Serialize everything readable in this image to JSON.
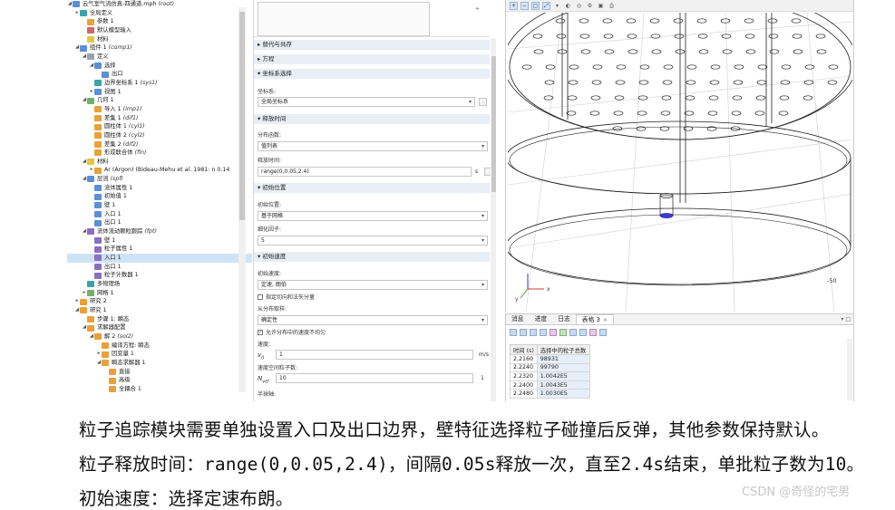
{
  "tree": {
    "rows": [
      {
        "indent": 0,
        "tw": "◢",
        "icon": "blue",
        "text": "云气室气流仿真-四通道.mph",
        "ital": "(root)",
        "iconName": "model-root-icon"
      },
      {
        "indent": 1,
        "tw": "▸",
        "icon": "teal",
        "text": "全局定义",
        "ital": "",
        "iconName": "global-definitions-icon"
      },
      {
        "indent": 2,
        "tw": "",
        "icon": "orange",
        "text": "参数 1",
        "ital": "",
        "iconName": "parameters-icon"
      },
      {
        "indent": 2,
        "tw": "",
        "icon": "red",
        "text": "默认模型输入",
        "ital": "",
        "iconName": "default-model-inputs-icon"
      },
      {
        "indent": 2,
        "tw": "",
        "icon": "yellow",
        "text": "材料",
        "ital": "",
        "iconName": "materials-icon"
      },
      {
        "indent": 1,
        "tw": "◢",
        "icon": "blue",
        "text": "组件 1",
        "ital": "(comp1)",
        "iconName": "component-icon"
      },
      {
        "indent": 2,
        "tw": "◢",
        "icon": "gray",
        "text": "定义",
        "ital": "",
        "iconName": "definitions-icon"
      },
      {
        "indent": 3,
        "tw": "◢",
        "icon": "blue",
        "text": "选择",
        "ital": "",
        "iconName": "selections-icon"
      },
      {
        "indent": 4,
        "tw": "",
        "icon": "blue",
        "text": "出口",
        "ital": "",
        "iconName": "selection-icon"
      },
      {
        "indent": 3,
        "tw": "",
        "icon": "teal",
        "text": "边界坐标系 1",
        "ital": "(sys1)",
        "iconName": "boundary-system-icon"
      },
      {
        "indent": 3,
        "tw": "▸",
        "icon": "blue",
        "text": "视图 1",
        "ital": "",
        "iconName": "view-icon"
      },
      {
        "indent": 2,
        "tw": "◢",
        "icon": "green",
        "text": "几何 1",
        "ital": "",
        "iconName": "geometry-icon"
      },
      {
        "indent": 3,
        "tw": "",
        "icon": "orange",
        "text": "导入 1",
        "ital": "(imp1)",
        "iconName": "import-icon"
      },
      {
        "indent": 3,
        "tw": "",
        "icon": "orange",
        "text": "差集 1",
        "ital": "(dif1)",
        "iconName": "difference-icon"
      },
      {
        "indent": 3,
        "tw": "",
        "icon": "orange",
        "text": "圆柱体 1",
        "ital": "(cyl1)",
        "iconName": "cylinder-icon"
      },
      {
        "indent": 3,
        "tw": "",
        "icon": "orange",
        "text": "圆柱体 2",
        "ital": "(cyl2)",
        "iconName": "cylinder-icon"
      },
      {
        "indent": 3,
        "tw": "",
        "icon": "orange",
        "text": "差集 2",
        "ital": "(dif2)",
        "iconName": "difference-icon"
      },
      {
        "indent": 3,
        "tw": "",
        "icon": "orange",
        "text": "形成联合体",
        "ital": "(fin)",
        "iconName": "form-union-icon"
      },
      {
        "indent": 2,
        "tw": "◢",
        "icon": "yellow",
        "text": "材料",
        "ital": "",
        "iconName": "materials-icon"
      },
      {
        "indent": 3,
        "tw": "▸",
        "icon": "orange",
        "text": "Ar (Argon) (Bideau-Mehu et al. 1981: n 0.14",
        "ital": "",
        "iconName": "material-icon"
      },
      {
        "indent": 2,
        "tw": "◢",
        "icon": "blue",
        "text": "层流",
        "ital": "(spf)",
        "iconName": "laminar-flow-icon"
      },
      {
        "indent": 3,
        "tw": "",
        "icon": "blue",
        "text": "流体属性 1",
        "ital": "",
        "iconName": "fluid-properties-icon"
      },
      {
        "indent": 3,
        "tw": "",
        "icon": "blue",
        "text": "初始值 1",
        "ital": "",
        "iconName": "initial-values-icon"
      },
      {
        "indent": 3,
        "tw": "",
        "icon": "blue",
        "text": "壁 1",
        "ital": "",
        "iconName": "wall-icon"
      },
      {
        "indent": 3,
        "tw": "",
        "icon": "blue",
        "text": "入口 1",
        "ital": "",
        "iconName": "inlet-icon"
      },
      {
        "indent": 3,
        "tw": "",
        "icon": "blue",
        "text": "出口 1",
        "ital": "",
        "iconName": "outlet-icon"
      },
      {
        "indent": 2,
        "tw": "◢",
        "icon": "purple",
        "text": "流体流动颗粒跟踪",
        "ital": "(fpt)",
        "iconName": "particle-tracing-icon"
      },
      {
        "indent": 3,
        "tw": "",
        "icon": "purple",
        "text": "壁 1",
        "ital": "",
        "iconName": "wall-icon"
      },
      {
        "indent": 3,
        "tw": "",
        "icon": "purple",
        "text": "粒子属性 1",
        "ital": "",
        "iconName": "particle-properties-icon"
      },
      {
        "indent": 3,
        "tw": "",
        "icon": "purple",
        "text": "入口 1",
        "ital": "",
        "iconName": "inlet-icon",
        "selected": true
      },
      {
        "indent": 3,
        "tw": "",
        "icon": "purple",
        "text": "出口 1",
        "ital": "",
        "iconName": "outlet-icon"
      },
      {
        "indent": 3,
        "tw": "",
        "icon": "purple",
        "text": "粒子计数器 1",
        "ital": "",
        "iconName": "particle-counter-icon"
      },
      {
        "indent": 2,
        "tw": "",
        "icon": "teal",
        "text": "多物理场",
        "ital": "",
        "iconName": "multiphysics-icon"
      },
      {
        "indent": 2,
        "tw": "▸",
        "icon": "green",
        "text": "网格 1",
        "ital": "",
        "iconName": "mesh-icon"
      },
      {
        "indent": 1,
        "tw": "▸",
        "icon": "orange",
        "text": "研究 2",
        "ital": "",
        "iconName": "study-icon"
      },
      {
        "indent": 1,
        "tw": "◢",
        "icon": "orange",
        "text": "研究 1",
        "ital": "",
        "iconName": "study-icon"
      },
      {
        "indent": 2,
        "tw": "",
        "icon": "orange",
        "text": "步骤 1: 瞬态",
        "ital": "",
        "iconName": "study-step-icon"
      },
      {
        "indent": 2,
        "tw": "◢",
        "icon": "orange",
        "text": "求解器配置",
        "ital": "",
        "iconName": "solver-configurations-icon"
      },
      {
        "indent": 3,
        "tw": "◢",
        "icon": "orange",
        "text": "解 2",
        "ital": "(sol2)",
        "iconName": "solution-icon"
      },
      {
        "indent": 4,
        "tw": "",
        "icon": "orange",
        "text": "编译方程: 瞬态",
        "ital": "",
        "iconName": "compile-equations-icon"
      },
      {
        "indent": 4,
        "tw": "▸",
        "icon": "orange",
        "text": "因变量 1",
        "ital": "",
        "iconName": "dependent-variables-icon"
      },
      {
        "indent": 4,
        "tw": "◢",
        "icon": "orange",
        "text": "瞬态求解器 1",
        "ital": "",
        "iconName": "time-dependent-solver-icon"
      },
      {
        "indent": 5,
        "tw": "",
        "icon": "orange",
        "text": "直接",
        "ital": "",
        "iconName": "direct-solver-icon"
      },
      {
        "indent": 5,
        "tw": "",
        "icon": "orange",
        "text": "高级",
        "ital": "",
        "iconName": "advanced-icon"
      },
      {
        "indent": 5,
        "tw": "",
        "icon": "orange",
        "text": "全耦合 1",
        "ital": "",
        "iconName": "fully-coupled-icon"
      }
    ]
  },
  "settings": {
    "sections": {
      "s1": "替代与共存",
      "s2": "方程",
      "s3": "坐标系选择",
      "s4": "释放时间",
      "s5": "初始位置",
      "s6": "初始速度"
    },
    "coord_label": "坐标系:",
    "coord_value": "全局坐标系",
    "dist_label": "分布函数:",
    "dist_value": "值列表",
    "release_label": "释放时间:",
    "release_value": "range(0,0.05,2.4)",
    "release_unit": "s",
    "init_pos_label": "初始位置:",
    "init_pos_value": "基于网格",
    "refine_label": "细化因子:",
    "refine_value": "5",
    "init_vel_label": "初始速度:",
    "init_vel_value": "定速, 朗伯",
    "specify_tangent": "指定切向和法矢分量",
    "sample_label": "从分布取样:",
    "sample_value": "确定性",
    "allow_nonuniform": "允许分布中的速度不均匀",
    "speed_label": "速度:",
    "v0_sym": "v",
    "v0_sub": "0",
    "v0_value": "1",
    "v0_unit": "m/s",
    "nvel_label": "速度空间粒子数:",
    "nvel_sym": "N",
    "nvel_sub": "vel",
    "nvel_value": "10",
    "nvel_unit": "1",
    "half_cone": "半球轴:"
  },
  "results": {
    "tabs": [
      "消息",
      "进度",
      "日志",
      "表格 3"
    ],
    "active_tab": 3,
    "columns": [
      "时间 (s)",
      "选择中的粒子总数"
    ],
    "rows": [
      [
        "2.2160",
        "98931"
      ],
      [
        "2.2240",
        "99790"
      ],
      [
        "2.2320",
        "1.0042E5"
      ],
      [
        "2.2400",
        "1.0043E5"
      ],
      [
        "2.2480",
        "1.0030E5"
      ]
    ]
  },
  "graphics": {
    "axis_value": "-50",
    "axis_x": "x",
    "axis_y": "y"
  },
  "caption": {
    "line1": "粒子追踪模块需要单独设置入口及出口边界，壁特征选择粒子碰撞后反弹，其他参数保持默认。",
    "line2": "粒子释放时间：range(0,0.05,2.4)，间隔0.05s释放一次，直至2.4s结束，单批粒子数为10。",
    "line3": "初始速度：选择定速布朗。"
  },
  "watermark": "CSDN @奇怪的宅男"
}
